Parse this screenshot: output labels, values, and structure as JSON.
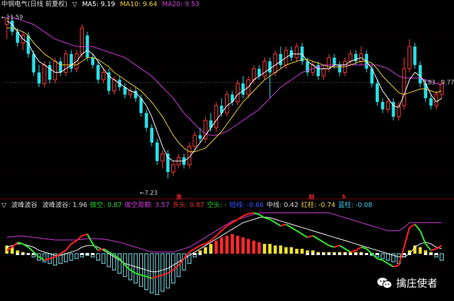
{
  "main_header": {
    "title": "中钢电气(日线 前夏权)",
    "ma5_label": "MA5: 9.19",
    "ma10_label": "MA10: 9.64",
    "ma20_label": "MA20: 9.53",
    "colors": {
      "ma5": "#ffffff",
      "ma10": "#f2d13a",
      "ma20": "#d23ce0",
      "title": "#dddddd"
    }
  },
  "price_labels": {
    "high": "11.59",
    "low": "7.23",
    "current": "9.83 - 9.77"
  },
  "event_markers": [
    "涨",
    "财",
    "$"
  ],
  "sub_header": {
    "title": "波峰波谷",
    "items": [
      {
        "label": "波峰波谷: 1.96",
        "color": "#dddddd"
      },
      {
        "label": "做空: 0.87",
        "color": "#29d12f"
      },
      {
        "label": "做空周期: 3.57",
        "color": "#d23ce0"
      },
      {
        "label": "多头: 0.87",
        "color": "#e8302a"
      },
      {
        "label": "空头: -",
        "color": "#29d12f"
      },
      {
        "label": "短线: -0.66",
        "color": "#3a54ff"
      },
      {
        "label": "中线: 0.42",
        "color": "#dddddd"
      },
      {
        "label": "红柱: -0.74",
        "color": "#f2d13a"
      },
      {
        "label": "蓝柱: -0.08",
        "color": "#42c8e8"
      }
    ]
  },
  "watermark": {
    "text": "擒庄使者"
  },
  "chart_data": {
    "type": "candlestick",
    "price_range": [
      6.9,
      11.8
    ],
    "candles": [
      [
        11.4,
        11.55,
        11.0,
        11.59
      ],
      [
        11.5,
        11.2,
        11.1,
        11.6
      ],
      [
        11.2,
        10.9,
        10.8,
        11.3
      ],
      [
        10.9,
        11.1,
        10.7,
        11.2
      ],
      [
        11.1,
        10.6,
        10.5,
        11.2
      ],
      [
        10.6,
        10.1,
        10.0,
        10.7
      ],
      [
        10.1,
        9.8,
        9.7,
        10.3
      ],
      [
        9.8,
        10.3,
        9.7,
        10.4
      ],
      [
        10.3,
        9.9,
        9.8,
        10.4
      ],
      [
        9.9,
        10.4,
        9.8,
        10.5
      ],
      [
        10.4,
        10.1,
        10.0,
        10.5
      ],
      [
        10.1,
        10.6,
        10.0,
        10.7
      ],
      [
        10.6,
        10.2,
        10.1,
        10.7
      ],
      [
        10.2,
        10.6,
        10.1,
        10.7
      ],
      [
        10.6,
        11.3,
        10.5,
        11.4
      ],
      [
        11.1,
        10.5,
        10.4,
        11.2
      ],
      [
        10.5,
        10.3,
        10.2,
        10.6
      ],
      [
        10.3,
        9.9,
        9.8,
        10.4
      ],
      [
        9.9,
        10.1,
        9.8,
        10.2
      ],
      [
        10.1,
        9.6,
        9.5,
        10.2
      ],
      [
        9.6,
        9.9,
        9.5,
        10.0
      ],
      [
        9.9,
        9.7,
        9.6,
        10.0
      ],
      [
        9.7,
        9.5,
        9.4,
        9.8
      ],
      [
        9.5,
        9.6,
        9.4,
        9.7
      ],
      [
        9.6,
        9.4,
        9.3,
        9.7
      ],
      [
        9.4,
        9.0,
        8.9,
        9.5
      ],
      [
        9.0,
        8.6,
        8.5,
        9.1
      ],
      [
        8.6,
        8.2,
        8.1,
        8.7
      ],
      [
        8.2,
        7.7,
        7.6,
        8.3
      ],
      [
        7.7,
        7.9,
        7.5,
        8.0
      ],
      [
        7.9,
        7.4,
        7.23,
        8.0
      ],
      [
        7.4,
        7.6,
        7.3,
        7.7
      ],
      [
        7.6,
        7.8,
        7.5,
        7.9
      ],
      [
        7.8,
        7.6,
        7.5,
        7.9
      ],
      [
        7.6,
        8.1,
        7.5,
        8.2
      ],
      [
        8.1,
        8.4,
        8.0,
        8.5
      ],
      [
        8.4,
        8.3,
        8.2,
        8.6
      ],
      [
        8.3,
        8.8,
        8.2,
        8.9
      ],
      [
        8.8,
        8.6,
        8.5,
        9.0
      ],
      [
        8.6,
        9.2,
        8.5,
        9.3
      ],
      [
        9.2,
        9.0,
        8.9,
        9.4
      ],
      [
        9.0,
        9.5,
        8.9,
        9.6
      ],
      [
        9.5,
        9.3,
        9.2,
        9.6
      ],
      [
        9.3,
        9.8,
        9.2,
        9.9
      ],
      [
        9.8,
        9.5,
        9.4,
        10.0
      ],
      [
        9.5,
        9.9,
        9.4,
        10.0
      ],
      [
        9.9,
        10.2,
        9.8,
        10.3
      ],
      [
        10.2,
        10.0,
        9.9,
        10.3
      ],
      [
        10.0,
        10.4,
        9.9,
        10.5
      ],
      [
        10.4,
        10.1,
        9.4,
        10.5
      ],
      [
        10.1,
        10.6,
        10.0,
        10.7
      ],
      [
        10.6,
        10.3,
        10.2,
        10.8
      ],
      [
        10.3,
        10.7,
        10.2,
        10.8
      ],
      [
        10.7,
        10.5,
        10.4,
        10.8
      ],
      [
        10.5,
        10.8,
        10.4,
        10.9
      ],
      [
        10.8,
        10.4,
        10.3,
        10.9
      ],
      [
        10.4,
        10.1,
        10.0,
        10.5
      ],
      [
        10.1,
        10.3,
        10.0,
        10.4
      ],
      [
        10.3,
        10.0,
        9.9,
        10.4
      ],
      [
        10.0,
        10.2,
        9.9,
        10.3
      ],
      [
        10.2,
        10.5,
        10.1,
        10.6
      ],
      [
        10.5,
        10.3,
        10.2,
        10.6
      ],
      [
        10.3,
        10.1,
        10.0,
        10.4
      ],
      [
        10.1,
        10.4,
        10.0,
        10.5
      ],
      [
        10.4,
        10.6,
        10.3,
        10.7
      ],
      [
        10.6,
        10.4,
        10.3,
        10.7
      ],
      [
        10.4,
        10.6,
        10.3,
        10.8
      ],
      [
        10.6,
        10.2,
        10.1,
        10.7
      ],
      [
        10.2,
        9.8,
        9.7,
        10.3
      ],
      [
        9.8,
        9.3,
        9.2,
        9.9
      ],
      [
        9.3,
        9.1,
        9.0,
        9.4
      ],
      [
        9.1,
        9.3,
        9.0,
        9.4
      ],
      [
        9.3,
        8.9,
        8.8,
        9.4
      ],
      [
        8.9,
        9.2,
        8.8,
        9.3
      ],
      [
        9.2,
        10.2,
        9.1,
        10.5
      ],
      [
        10.2,
        10.8,
        10.1,
        11.0
      ],
      [
        10.8,
        10.3,
        10.2,
        10.9
      ],
      [
        10.3,
        9.8,
        9.7,
        10.4
      ],
      [
        9.8,
        9.4,
        9.3,
        9.9
      ],
      [
        9.4,
        9.2,
        9.1,
        9.5
      ],
      [
        9.2,
        9.5,
        9.1,
        9.6
      ],
      [
        9.5,
        9.8,
        9.4,
        9.9
      ]
    ],
    "ma5": [
      11.5,
      11.4,
      11.2,
      11.0,
      10.9,
      10.6,
      10.4,
      10.3,
      10.2,
      10.1,
      10.1,
      10.2,
      10.3,
      10.4,
      10.6,
      10.7,
      10.6,
      10.4,
      10.2,
      10.0,
      9.9,
      9.8,
      9.7,
      9.6,
      9.55,
      9.4,
      9.2,
      8.9,
      8.5,
      8.1,
      7.8,
      7.7,
      7.7,
      7.7,
      7.8,
      8.0,
      8.2,
      8.4,
      8.6,
      8.8,
      9.0,
      9.2,
      9.3,
      9.5,
      9.6,
      9.7,
      9.9,
      10.0,
      10.1,
      10.2,
      10.3,
      10.4,
      10.5,
      10.6,
      10.6,
      10.6,
      10.4,
      10.3,
      10.2,
      10.2,
      10.2,
      10.3,
      10.3,
      10.3,
      10.4,
      10.45,
      10.5,
      10.4,
      10.2,
      9.9,
      9.6,
      9.4,
      9.2,
      9.15,
      9.5,
      9.9,
      10.1,
      10.0,
      9.8,
      9.5,
      9.3,
      9.4
    ],
    "ma10": [
      11.3,
      11.3,
      11.25,
      11.2,
      11.1,
      10.9,
      10.75,
      10.6,
      10.5,
      10.4,
      10.3,
      10.3,
      10.3,
      10.3,
      10.4,
      10.5,
      10.5,
      10.45,
      10.35,
      10.25,
      10.1,
      10.0,
      9.9,
      9.8,
      9.7,
      9.6,
      9.45,
      9.3,
      9.1,
      8.9,
      8.65,
      8.4,
      8.2,
      8.05,
      7.95,
      7.95,
      8.0,
      8.05,
      8.2,
      8.35,
      8.5,
      8.7,
      8.9,
      9.1,
      9.3,
      9.45,
      9.6,
      9.75,
      9.9,
      10.0,
      10.1,
      10.2,
      10.3,
      10.35,
      10.4,
      10.45,
      10.45,
      10.4,
      10.35,
      10.3,
      10.25,
      10.25,
      10.25,
      10.25,
      10.3,
      10.35,
      10.4,
      10.4,
      10.35,
      10.2,
      10.0,
      9.85,
      9.7,
      9.55,
      9.5,
      9.55,
      9.6,
      9.65,
      9.65,
      9.6,
      9.55,
      9.6
    ],
    "ma20": [
      11.6,
      11.6,
      11.55,
      11.5,
      11.45,
      11.4,
      11.3,
      11.2,
      11.1,
      11.0,
      10.95,
      10.9,
      10.85,
      10.8,
      10.8,
      10.8,
      10.8,
      10.75,
      10.7,
      10.65,
      10.6,
      10.55,
      10.5,
      10.4,
      10.3,
      10.2,
      10.1,
      10.0,
      9.85,
      9.7,
      9.55,
      9.4,
      9.2,
      9.0,
      8.85,
      8.7,
      8.55,
      8.45,
      8.4,
      8.4,
      8.45,
      8.5,
      8.6,
      8.7,
      8.8,
      8.9,
      9.0,
      9.1,
      9.25,
      9.4,
      9.55,
      9.7,
      9.8,
      9.9,
      10.0,
      10.1,
      10.15,
      10.2,
      10.25,
      10.3,
      10.3,
      10.3,
      10.3,
      10.3,
      10.3,
      10.3,
      10.3,
      10.3,
      10.3,
      10.3,
      10.25,
      10.2,
      10.1,
      10.0,
      9.95,
      9.95,
      9.95,
      9.95,
      9.9,
      9.85,
      9.8,
      9.75
    ],
    "osc_range": [
      -1.3,
      1.3
    ],
    "osc_white": [
      0.2,
      0.25,
      0.3,
      0.3,
      0.25,
      0.2,
      0.1,
      0.05,
      0.0,
      -0.05,
      -0.05,
      0.0,
      0.05,
      0.1,
      0.2,
      0.25,
      0.25,
      0.2,
      0.1,
      0.0,
      -0.1,
      -0.2,
      -0.3,
      -0.35,
      -0.4,
      -0.45,
      -0.5,
      -0.55,
      -0.55,
      -0.5,
      -0.45,
      -0.35,
      -0.25,
      -0.15,
      -0.05,
      0.05,
      0.15,
      0.25,
      0.35,
      0.45,
      0.55,
      0.65,
      0.75,
      0.85,
      0.95,
      1.0,
      1.05,
      1.1,
      1.12,
      1.1,
      1.05,
      1.0,
      0.95,
      0.9,
      0.85,
      0.8,
      0.75,
      0.7,
      0.65,
      0.6,
      0.55,
      0.5,
      0.45,
      0.4,
      0.35,
      0.3,
      0.25,
      0.2,
      0.15,
      0.1,
      0.05,
      0.0,
      -0.05,
      -0.1,
      -0.1,
      0.0,
      0.2,
      0.3,
      0.35,
      0.3,
      0.2,
      0.15
    ],
    "osc_red_green": [
      0.1,
      0.2,
      0.35,
      0.3,
      0.2,
      0.05,
      -0.1,
      -0.2,
      -0.15,
      -0.1,
      0.0,
      0.1,
      0.3,
      0.4,
      0.55,
      0.6,
      0.3,
      0.1,
      0.15,
      0.05,
      -0.05,
      -0.15,
      -0.35,
      -0.5,
      -0.6,
      -0.65,
      -0.7,
      -0.75,
      -0.7,
      -0.65,
      -0.6,
      -0.5,
      -0.35,
      -0.15,
      0.05,
      0.15,
      0.25,
      0.3,
      0.4,
      0.55,
      0.7,
      0.85,
      0.95,
      1.05,
      1.15,
      1.22,
      1.25,
      1.2,
      1.1,
      1.05,
      0.95,
      0.85,
      0.9,
      0.8,
      0.7,
      0.6,
      0.5,
      0.55,
      0.45,
      0.35,
      0.25,
      0.2,
      0.25,
      0.15,
      0.05,
      0.1,
      0.2,
      0.15,
      0.0,
      -0.15,
      -0.2,
      -0.3,
      -0.4,
      -0.35,
      0.2,
      0.8,
      0.9,
      0.7,
      0.3,
      0.1,
      0.15,
      0.25
    ],
    "osc_magenta": [
      0.5,
      0.52,
      0.54,
      0.54,
      0.52,
      0.5,
      0.48,
      0.46,
      0.44,
      0.42,
      0.42,
      0.42,
      0.42,
      0.42,
      0.44,
      0.46,
      0.46,
      0.46,
      0.44,
      0.42,
      0.38,
      0.35,
      0.3,
      0.25,
      0.2,
      0.15,
      0.1,
      0.05,
      0.05,
      0.05,
      0.05,
      0.05,
      0.1,
      0.15,
      0.2,
      0.3,
      0.4,
      0.5,
      0.6,
      0.7,
      0.8,
      0.9,
      1.0,
      1.05,
      1.1,
      1.15,
      1.2,
      1.25,
      1.25,
      1.25,
      1.25,
      1.25,
      1.25,
      1.25,
      1.25,
      1.25,
      1.25,
      1.25,
      1.25,
      1.25,
      1.25,
      1.2,
      1.15,
      1.1,
      1.05,
      1.0,
      0.95,
      0.9,
      0.85,
      0.8,
      0.75,
      0.7,
      0.7,
      0.7,
      0.8,
      0.95,
      0.95,
      0.95,
      0.95,
      0.95,
      0.95,
      0.95
    ],
    "osc_bars": [
      0.25,
      0.2,
      0.1,
      0.05,
      0.0,
      -0.1,
      -0.2,
      -0.25,
      -0.3,
      -0.35,
      -0.3,
      -0.25,
      -0.2,
      -0.15,
      -0.1,
      -0.05,
      -0.1,
      -0.2,
      -0.3,
      -0.4,
      -0.5,
      -0.6,
      -0.7,
      -0.8,
      -0.9,
      -1.0,
      -1.1,
      -1.2,
      -1.25,
      -1.15,
      -1.05,
      -0.9,
      -0.7,
      -0.5,
      -0.3,
      -0.1,
      0.1,
      0.2,
      0.3,
      0.4,
      0.5,
      0.55,
      0.6,
      0.55,
      0.5,
      0.45,
      0.4,
      0.35,
      0.3,
      0.3,
      0.25,
      0.25,
      0.2,
      0.2,
      0.15,
      0.15,
      0.1,
      0.1,
      0.05,
      0.05,
      0.05,
      0.05,
      0.05,
      0.05,
      0.05,
      0.05,
      0.05,
      0.0,
      -0.05,
      -0.1,
      -0.15,
      -0.2,
      -0.25,
      -0.3,
      -0.1,
      0.1,
      0.25,
      0.2,
      0.1,
      0.05,
      -0.1,
      -0.2
    ]
  }
}
